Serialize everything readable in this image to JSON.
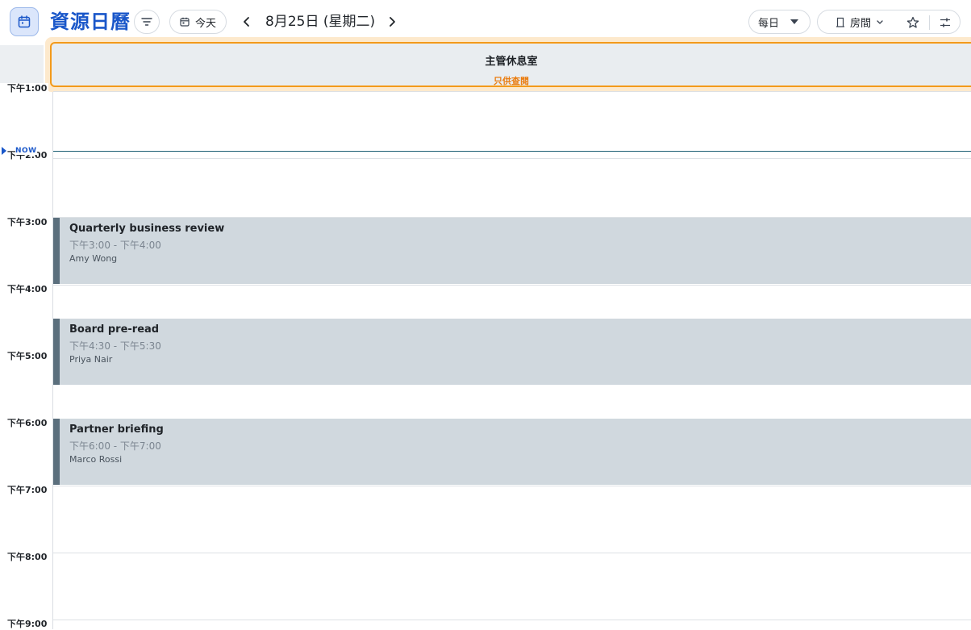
{
  "header": {
    "app_title": "資源日曆",
    "today_label": "今天",
    "date_label": "8月25日 (星期二)",
    "view_label": "每日",
    "room_label": "房間"
  },
  "resource": {
    "name": "主管休息室",
    "badge": "只供查閱"
  },
  "now_label": "NOW",
  "hours": [
    "下午1:00",
    "下午2:00",
    "下午3:00",
    "下午4:00",
    "下午5:00",
    "下午6:00",
    "下午7:00",
    "下午8:00",
    "下午9:00"
  ],
  "events": [
    {
      "title": "Quarterly business review",
      "time": "下午3:00 - 下午4:00",
      "owner": "Amy Wong"
    },
    {
      "title": "Board pre-read",
      "time": "下午4:30 - 下午5:30",
      "owner": "Priya Nair"
    },
    {
      "title": "Partner briefing",
      "time": "下午6:00 - 下午7:00",
      "owner": "Marco Rossi"
    }
  ],
  "colors": {
    "brand": "#1a57c9",
    "readonly_accent": "#f39a1a",
    "event_bg": "#d0d8de",
    "event_border": "#5b6f7d",
    "now_line": "#1b5e74"
  }
}
